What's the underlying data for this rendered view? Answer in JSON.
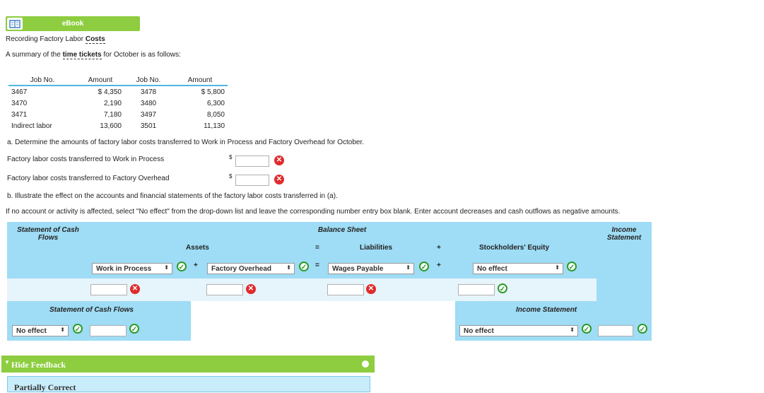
{
  "ebook": {
    "label": "eBook"
  },
  "heading": {
    "title_prefix": "Recording Factory Labor ",
    "title_link": "Costs",
    "summary_prefix": "A summary of the ",
    "summary_link": "time tickets",
    "summary_suffix": " for October is as follows:"
  },
  "jobs_table": {
    "headers": [
      "Job No.",
      "Amount",
      "Job No.",
      "Amount"
    ],
    "rows": [
      [
        "3467",
        "$ 4,350",
        "3478",
        "$ 5,800"
      ],
      [
        "3470",
        "2,190",
        "3480",
        "6,300"
      ],
      [
        "3471",
        "7,180",
        "3497",
        "8,050"
      ],
      [
        "Indirect labor",
        "13,600",
        "3501",
        "11,130"
      ]
    ]
  },
  "part_a": {
    "instruction": "a.  Determine the amounts of factory labor costs transferred to Work in Process and Factory Overhead for October.",
    "wip_label": "Factory labor costs transferred to Work in Process",
    "fo_label": "Factory labor costs transferred to Factory Overhead",
    "currency": "$"
  },
  "part_b": {
    "instruction": "b.  Illustrate the effect on the accounts and financial statements of the factory labor costs transferred in (a).",
    "note": "If no account or activity is affected, select \"No effect\" from the drop-down list and leave the corresponding number entry box blank. Enter account decreases and cash outflows as negative amounts."
  },
  "grid": {
    "cash_flows_header": "Statement of Cash Flows",
    "balance_sheet_header": "Balance Sheet",
    "income_statement_header": "Income Statement",
    "assets": "Assets",
    "equals": "=",
    "liabilities": "Liabilities",
    "plus": "+",
    "equity": "Stockholders' Equity",
    "sel_asset1": "Work in Process",
    "sel_asset2": "Factory Overhead",
    "sel_liab": "Wages Payable",
    "sel_equity": "No effect",
    "cf_bottom_header": "Statement of Cash Flows",
    "is_bottom_header": "Income Statement",
    "sel_cf": "No effect",
    "sel_is": "No effect"
  },
  "feedback": {
    "toggle": "Hide Feedback",
    "status": "Partially Correct"
  },
  "colors": {
    "green": "#8dcd3f",
    "blue": "#9fdcf5",
    "error": "#e02b2b",
    "check": "#2a9c2a"
  }
}
